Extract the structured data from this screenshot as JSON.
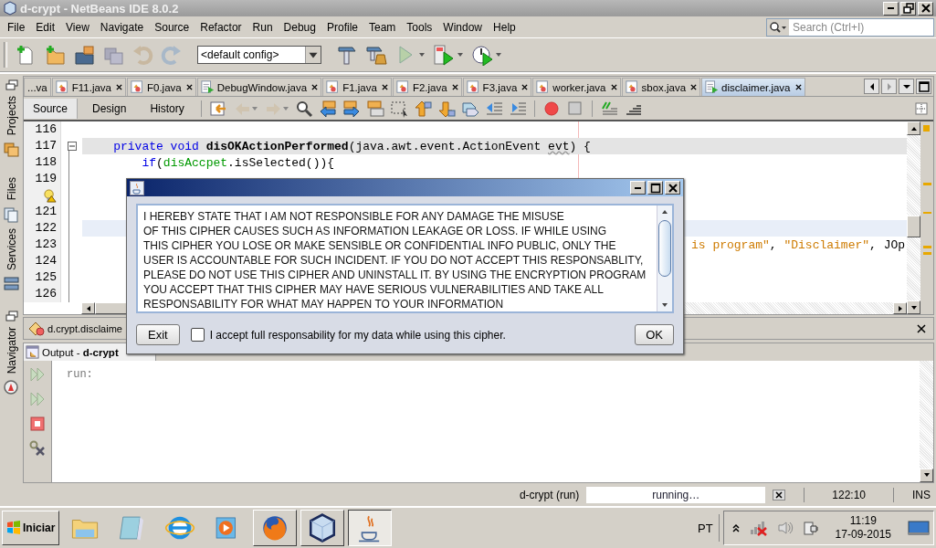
{
  "window": {
    "title": "d-crypt - NetBeans IDE 8.0.2"
  },
  "menu": [
    "File",
    "Edit",
    "View",
    "Navigate",
    "Source",
    "Refactor",
    "Run",
    "Debug",
    "Profile",
    "Team",
    "Tools",
    "Window",
    "Help"
  ],
  "search": {
    "placeholder": "Search (Ctrl+I)"
  },
  "toolbar": {
    "config": "<default config>"
  },
  "side_tabs": [
    {
      "label": "Projects",
      "kind": "projects"
    },
    {
      "label": "Files",
      "kind": "files"
    },
    {
      "label": "Services",
      "kind": "services"
    },
    {
      "label": "Navigator",
      "kind": "navigator"
    }
  ],
  "editor_tabs": [
    {
      "label": "...va",
      "kind": "none",
      "closable": false,
      "selected": false
    },
    {
      "label": "F11.java",
      "kind": "form",
      "closable": true,
      "selected": false
    },
    {
      "label": "F0.java",
      "kind": "form",
      "closable": true,
      "selected": false
    },
    {
      "label": "DebugWindow.java",
      "kind": "runnable",
      "closable": true,
      "selected": false
    },
    {
      "label": "F1.java",
      "kind": "form",
      "closable": true,
      "selected": false
    },
    {
      "label": "F2.java",
      "kind": "form",
      "closable": true,
      "selected": false
    },
    {
      "label": "F3.java",
      "kind": "form",
      "closable": true,
      "selected": false
    },
    {
      "label": "worker.java",
      "kind": "form",
      "closable": true,
      "selected": false
    },
    {
      "label": "sbox.java",
      "kind": "form",
      "closable": true,
      "selected": false
    },
    {
      "label": "disclaimer.java",
      "kind": "runnable",
      "closable": true,
      "selected": true
    }
  ],
  "view_tabs": [
    {
      "label": "Source",
      "selected": true
    },
    {
      "label": "Design",
      "selected": false
    },
    {
      "label": "History",
      "selected": false
    }
  ],
  "code_lines": [
    {
      "kind": "number",
      "number": "116",
      "highlighted": false,
      "current": false,
      "fold": false
    },
    {
      "kind": "number",
      "number": "117",
      "highlighted": true,
      "current": false,
      "fold": true,
      "tokens": [
        {
          "t": "    private void ",
          "kind": "keyword"
        },
        {
          "t": "disOKActionPerformed",
          "kind": "method"
        },
        {
          "t": "(java.awt.event.ActionEvent ",
          "kind": "plain"
        },
        {
          "t": "evt",
          "kind": "unused"
        },
        {
          "t": ") {",
          "kind": "plain"
        }
      ]
    },
    {
      "kind": "number",
      "number": "118",
      "highlighted": false,
      "current": false,
      "fold": false,
      "tokens": [
        {
          "t": "        if",
          "kind": "keyword"
        },
        {
          "t": "(",
          "kind": "plain"
        },
        {
          "t": "disAccpet",
          "kind": "field"
        },
        {
          "t": ".isSelected()){",
          "kind": "plain"
        }
      ]
    },
    {
      "kind": "number",
      "number": "119",
      "highlighted": false,
      "current": false,
      "fold": false
    },
    {
      "kind": "hint",
      "highlighted": false,
      "current": false,
      "fold": false
    },
    {
      "kind": "number",
      "number": "121",
      "highlighted": false,
      "current": false,
      "fold": false
    },
    {
      "kind": "number",
      "number": "122",
      "highlighted": false,
      "current": true,
      "fold": false
    },
    {
      "kind": "number",
      "number": "123",
      "highlighted": false,
      "current": false,
      "fold": false,
      "tail": [
        {
          "t": "is program\"",
          "kind": "string"
        },
        {
          "t": ", ",
          "kind": "plain"
        },
        {
          "t": "\"Disclaimer\"",
          "kind": "string"
        },
        {
          "t": ", JOp",
          "kind": "plain"
        }
      ]
    },
    {
      "kind": "number",
      "number": "124",
      "highlighted": false,
      "current": false,
      "fold": false
    },
    {
      "kind": "number",
      "number": "125",
      "highlighted": false,
      "current": false,
      "fold": false
    },
    {
      "kind": "number",
      "number": "126",
      "highlighted": false,
      "current": false,
      "fold": false
    }
  ],
  "navigator": {
    "title": "d.crypt.disclaime"
  },
  "output": {
    "title": "Output - **d-crypt**",
    "lines": [
      "run:"
    ]
  },
  "status_bar": {
    "task": "d-crypt (run)",
    "progress": "running…",
    "position": "122:10",
    "mode": "INS"
  },
  "dialog": {
    "text_lines": [
      "I HEREBY STATE THAT I AM NOT RESPONSIBLE FOR ANY DAMAGE THE MISUSE",
      "OF THIS CIPHER CAUSES SUCH AS INFORMATION LEAKAGE OR LOSS. IF WHILE USING",
      "THIS CIPHER YOU LOSE OR MAKE SENSIBLE OR CONFIDENTIAL INFO PUBLIC, ONLY THE",
      "USER IS ACCOUNTABLE FOR SUCH INCIDENT. IF YOU DO NOT ACCEPT THIS RESPONSABLITY,",
      "PLEASE DO NOT USE THIS CIPHER AND UNINSTALL IT. BY USING THE ENCRYPTION PROGRAM",
      "YOU ACCEPT THAT THIS CIPHER MAY HAVE SERIOUS VULNERABILITIES AND TAKE ALL",
      "RESPONSABILITY FOR WHAT MAY HAPPEN TO YOUR INFORMATION"
    ],
    "exit": "Exit",
    "accept": {
      "label": "I accept full responsability for my data while using this cipher.",
      "checked": false
    },
    "ok": "OK"
  },
  "taskbar": {
    "start": "Iniciar",
    "apps": [
      {
        "kind": "explorer",
        "running": false,
        "selected": false
      },
      {
        "kind": "notepad",
        "running": false,
        "selected": false
      },
      {
        "kind": "browser",
        "running": false,
        "selected": false
      },
      {
        "kind": "media",
        "running": false,
        "selected": false
      },
      {
        "kind": "firefox",
        "running": true,
        "selected": false
      },
      {
        "kind": "cube",
        "running": true,
        "selected": false
      },
      {
        "kind": "java",
        "running": true,
        "selected": true
      }
    ],
    "language": "PT",
    "time": "11:19",
    "date": "17-09-2015"
  }
}
